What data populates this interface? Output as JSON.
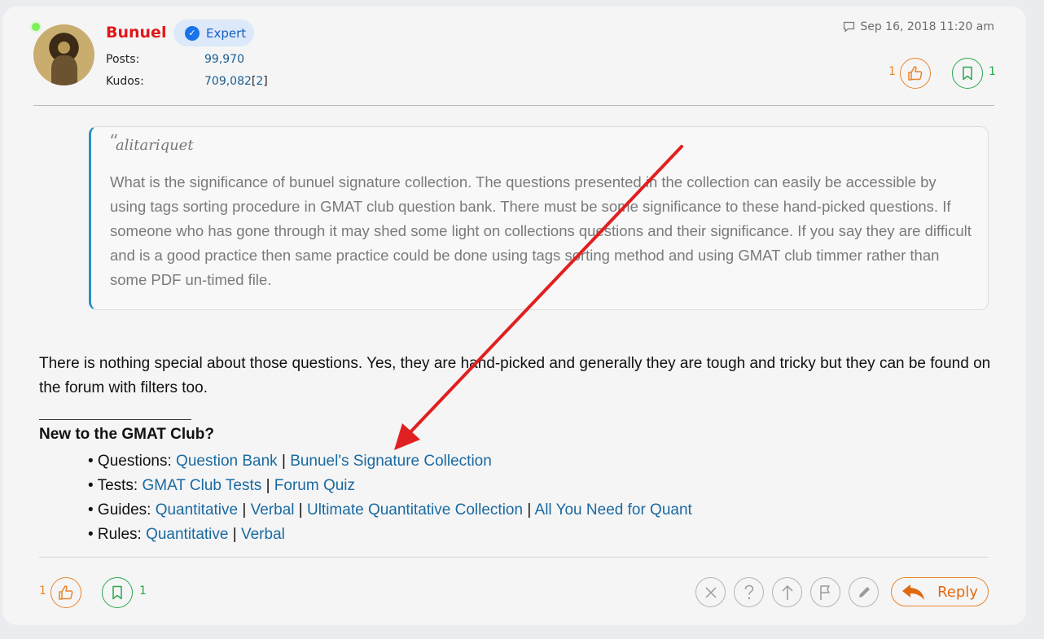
{
  "post": {
    "username": "Bunuel",
    "badge": "Expert",
    "posts_label": "Posts:",
    "posts_value": "99,970",
    "kudos_label": "Kudos:",
    "kudos_value": "709,082",
    "kudos_bracket_open": "[",
    "kudos_extra": "2",
    "kudos_bracket_close": "]",
    "timestamp": "Sep 16, 2018 11:20 am",
    "top_kudos_count": "1",
    "top_bookmark_count": "1"
  },
  "quote": {
    "mark": "“",
    "author": "alitariquet",
    "text": "What is the significance of bunuel signature collection. The questions presented in the collection can easily be accessible by using tags sorting procedure in GMAT club question bank. There must be some significance to these hand-picked questions. If someone who has gone through it may shed some light on collections questions and their significance. If you say they are difficult and is a good practice then same practice could be done using tags sorting method and using GMAT club timmer rather than some PDF un-timed file."
  },
  "reply_text": "There is nothing special about those questions. Yes, they are hand-picked and generally they are tough and tricky but they can be found on the forum with filters too.",
  "signature": {
    "title": "New to the GMAT Club?",
    "separator": "|",
    "rows": [
      {
        "bullet": "• Questions: ",
        "links": [
          "Question Bank",
          "Bunuel's Signature Collection"
        ]
      },
      {
        "bullet": "• Tests: ",
        "links": [
          "GMAT Club Tests",
          "Forum Quiz"
        ]
      },
      {
        "bullet": "• Guides: ",
        "links": [
          "Quantitative",
          "Verbal",
          "Ultimate Quantitative Collection",
          "All You Need for Quant"
        ]
      },
      {
        "bullet": "• Rules: ",
        "links": [
          "Quantitative",
          "Verbal"
        ]
      }
    ]
  },
  "footer": {
    "kudos_count": "1",
    "bookmark_count": "1",
    "reply_label": "Reply"
  },
  "colors": {
    "username": "#e3161a",
    "link": "#1a6aa0",
    "kudos": "#e8852a",
    "bookmark": "#2aa84a",
    "annotation_arrow": "#e02020"
  },
  "icons": [
    "online-status-dot",
    "verified-check-icon",
    "comment-icon",
    "thumbs-up-icon",
    "bookmark-icon",
    "close-icon",
    "question-icon",
    "arrow-up-icon",
    "flag-icon",
    "pencil-icon",
    "reply-arrow-icon"
  ]
}
